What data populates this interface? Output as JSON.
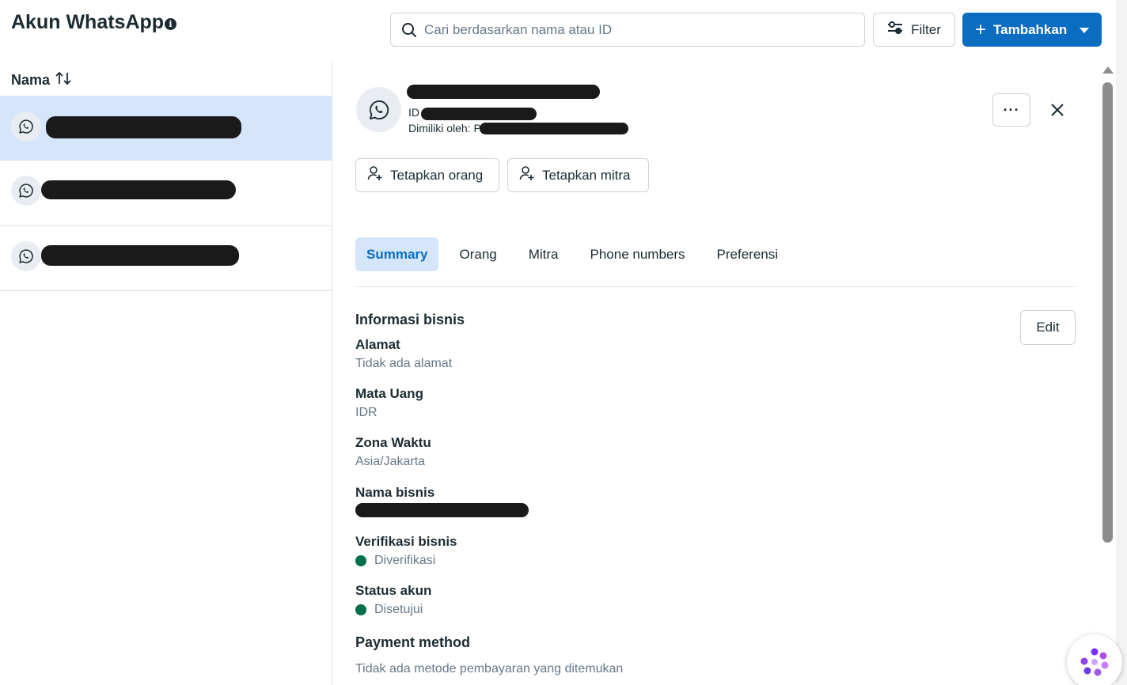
{
  "header": {
    "title": "Akun WhatsApp",
    "info_icon": "info-icon",
    "search": {
      "placeholder": "Cari berdasarkan nama atau ID",
      "value": ""
    },
    "filter_label": "Filter",
    "add_label": "Tambahkan"
  },
  "list": {
    "column_header": "Nama",
    "sort_icon": "sort-arrows-icon",
    "items": [
      {
        "icon": "whatsapp-icon",
        "selected": true
      },
      {
        "icon": "whatsapp-icon",
        "selected": false
      },
      {
        "icon": "whatsapp-icon",
        "selected": false
      }
    ]
  },
  "detail": {
    "id_label": "ID",
    "owned_label": "Dimiliki oleh: P",
    "assign_person_label": "Tetapkan orang",
    "assign_partner_label": "Tetapkan mitra",
    "tabs": [
      {
        "label": "Summary",
        "active": true
      },
      {
        "label": "Orang",
        "active": false
      },
      {
        "label": "Mitra",
        "active": false
      },
      {
        "label": "Phone numbers",
        "active": false
      },
      {
        "label": "Preferensi",
        "active": false
      }
    ],
    "business_info_title": "Informasi bisnis",
    "edit_label": "Edit",
    "fields": {
      "address": {
        "label": "Alamat",
        "value": "Tidak ada alamat"
      },
      "currency": {
        "label": "Mata Uang",
        "value": "IDR"
      },
      "timezone": {
        "label": "Zona Waktu",
        "value": "Asia/Jakarta"
      },
      "business_name": {
        "label": "Nama bisnis"
      },
      "verification": {
        "label": "Verifikasi bisnis",
        "value": "Diverifikasi"
      },
      "account_status": {
        "label": "Status akun",
        "value": "Disetujui"
      }
    },
    "payment_title": "Payment method",
    "payment_value": "Tidak ada metode pembayaran yang ditemukan"
  },
  "colors": {
    "accent": "#0a6dc2",
    "selected_bg": "#d5e6fa",
    "status_green": "#00704a"
  }
}
